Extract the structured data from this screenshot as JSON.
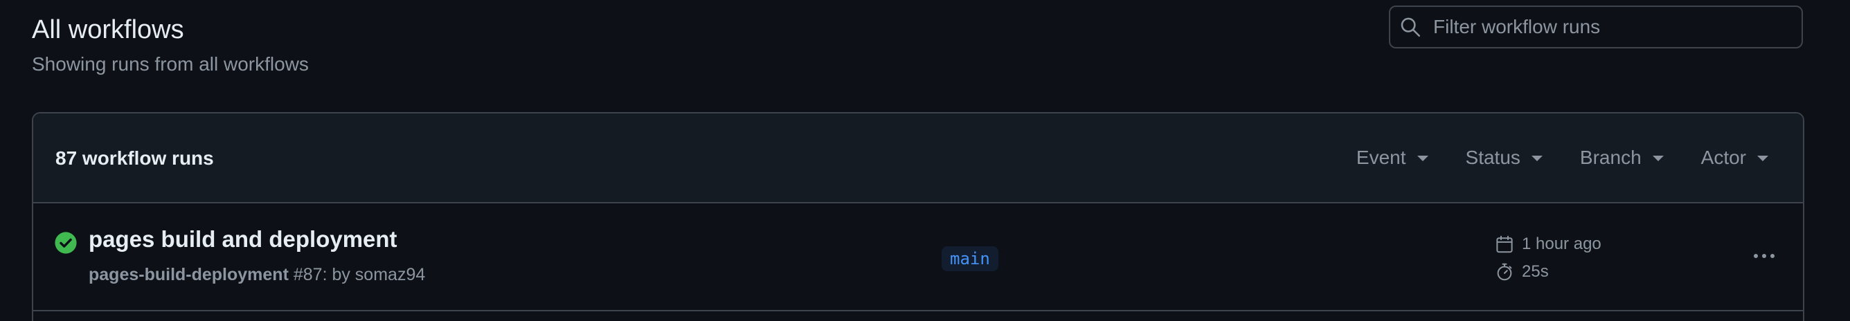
{
  "header": {
    "title": "All workflows",
    "subtitle": "Showing runs from all workflows"
  },
  "search": {
    "placeholder": "Filter workflow runs",
    "value": ""
  },
  "runs_header": {
    "count_label": "87 workflow runs",
    "filters": [
      {
        "label": "Event"
      },
      {
        "label": "Status"
      },
      {
        "label": "Branch"
      },
      {
        "label": "Actor"
      }
    ]
  },
  "runs": [
    {
      "title": "pages build and deployment",
      "workflow": "pages-build-deployment",
      "meta_suffix": "#87: by somaz94",
      "branch": "main",
      "time": "1 hour ago",
      "duration": "25s",
      "status": "success",
      "status_color": "#3fb950",
      "status_icon": "check-circle-icon"
    }
  ],
  "colors": {
    "background": "#0d1117",
    "header_bg": "#151b23",
    "border": "#3d444d",
    "muted": "#8d96a0",
    "accent": "#4493f8"
  }
}
